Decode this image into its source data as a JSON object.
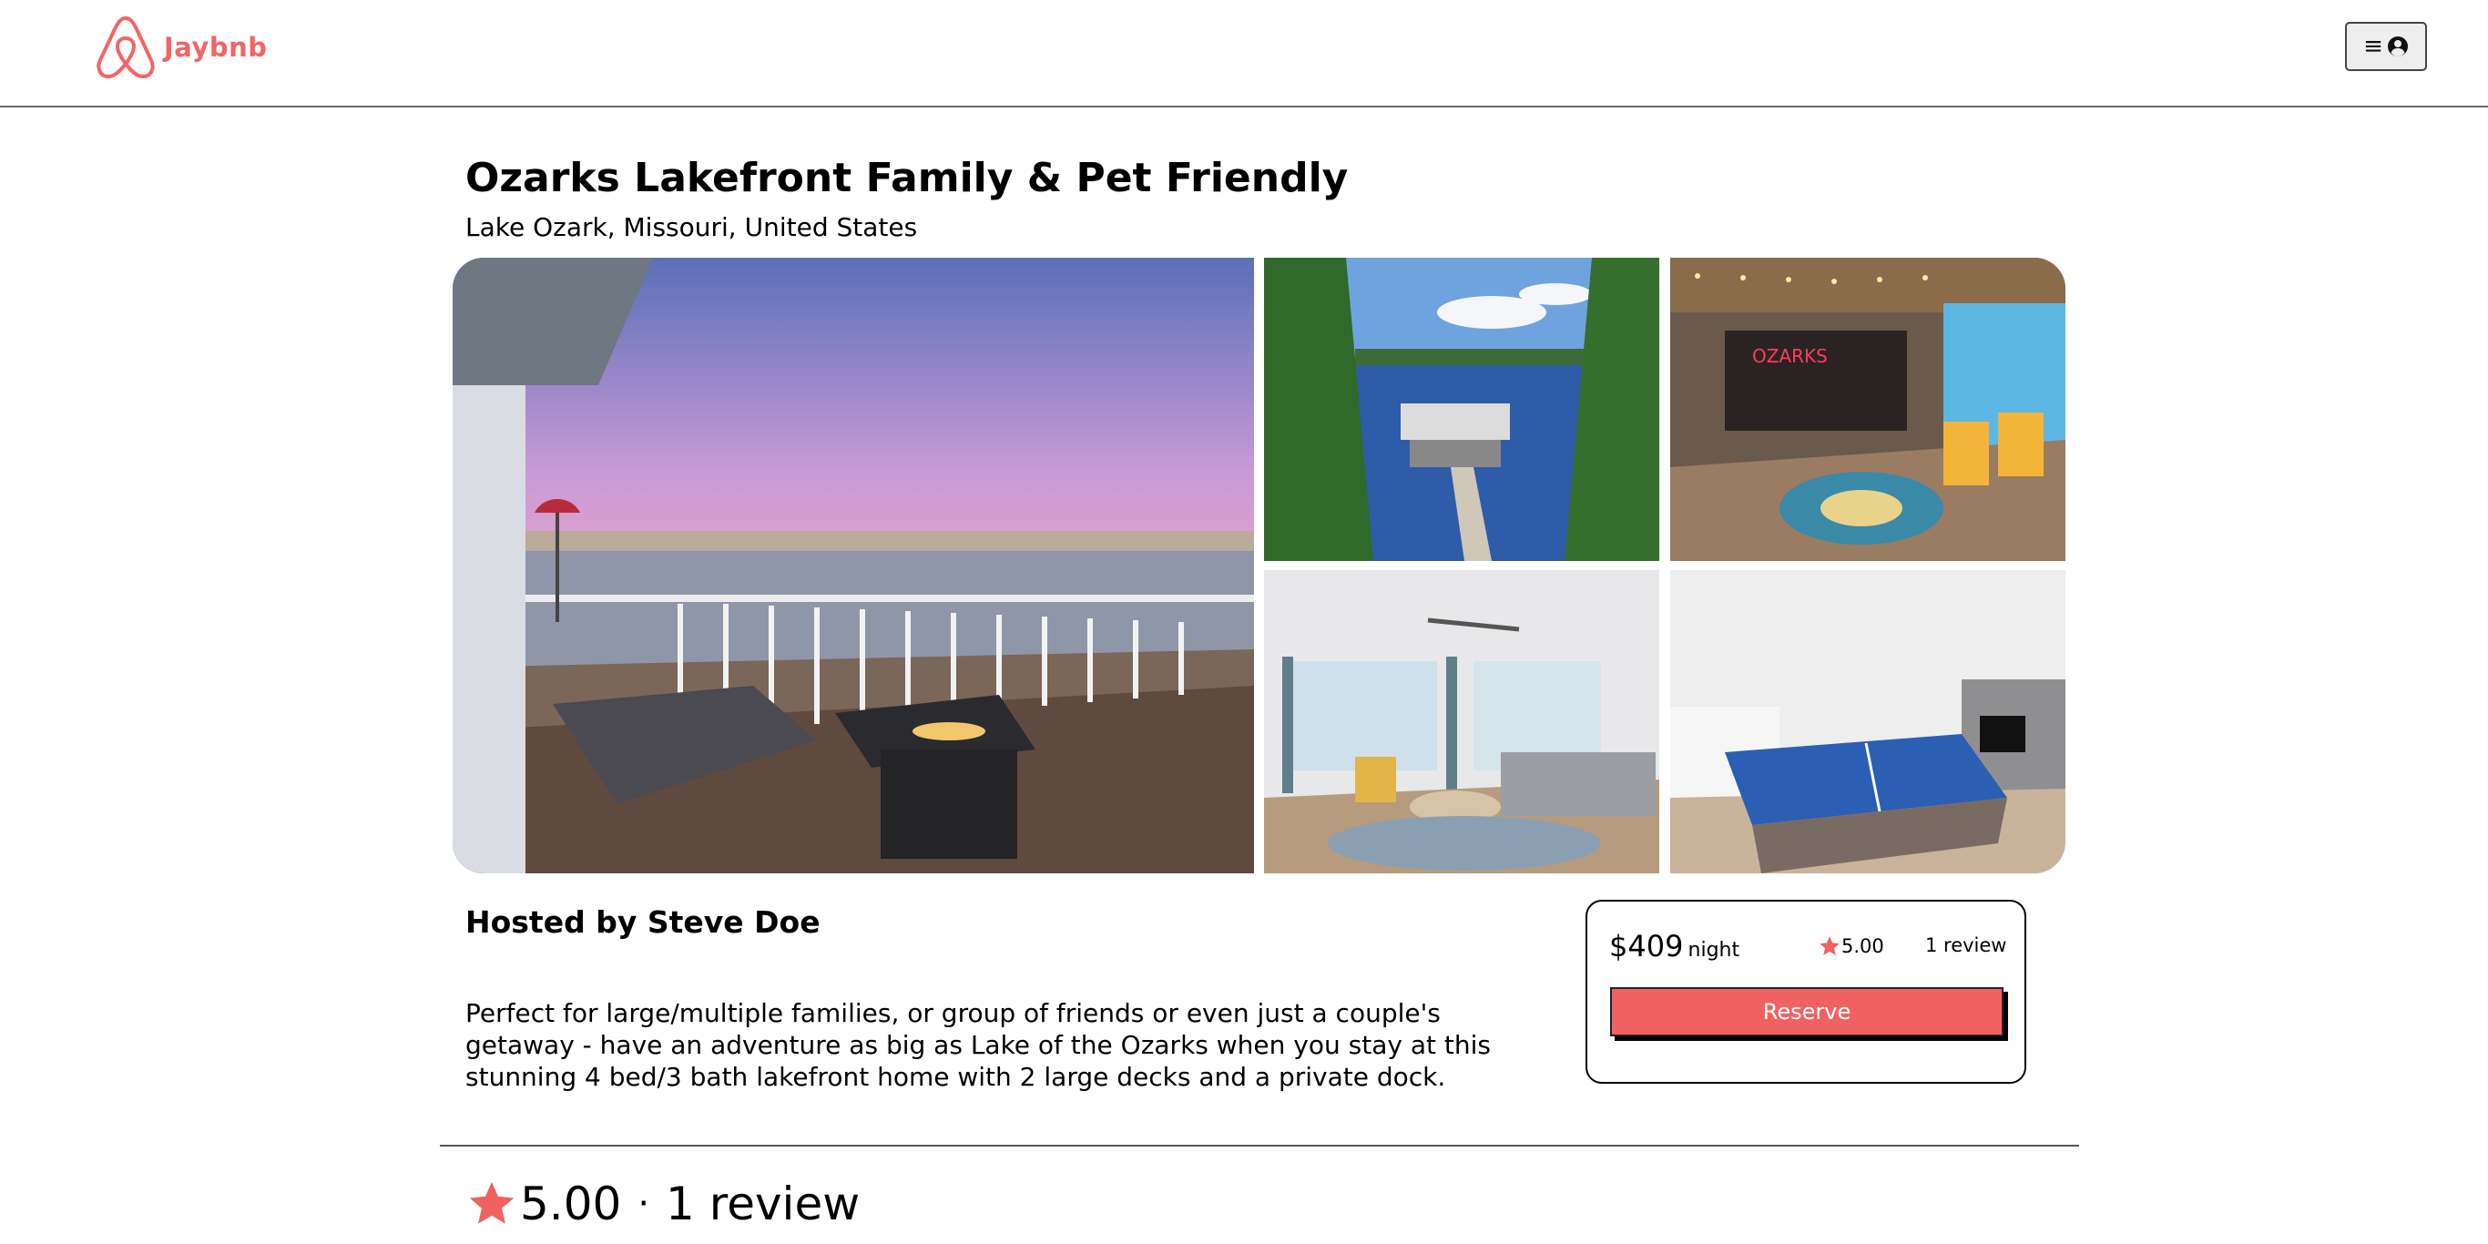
{
  "brand": {
    "name": "Jaybnb",
    "color": "#f26565"
  },
  "nav": {
    "menu_icon": "hamburger-icon",
    "profile_icon": "user-circle-icon",
    "menu_glyph": "≡"
  },
  "listing": {
    "title": "Ozarks Lakefront Family & Pet Friendly",
    "location": "Lake Ozark, Missouri, United States",
    "host": "Hosted by Steve Doe",
    "description": "Perfect for large/multiple families, or group of friends or even just a couple's getaway - have an adventure as big as Lake of the Ozarks when you stay at this stunning 4 bed/3 bath lakefront home with 2 large decks and a private dock."
  },
  "booking": {
    "price": "$409",
    "unit": "night",
    "rating": "5.00",
    "reviews": "1 review",
    "reserve_label": "Reserve",
    "accent": "#f06262"
  },
  "reviews_section": {
    "rating": "5.00",
    "separator": "·",
    "count": "1 review",
    "star_color": "#f06262"
  }
}
